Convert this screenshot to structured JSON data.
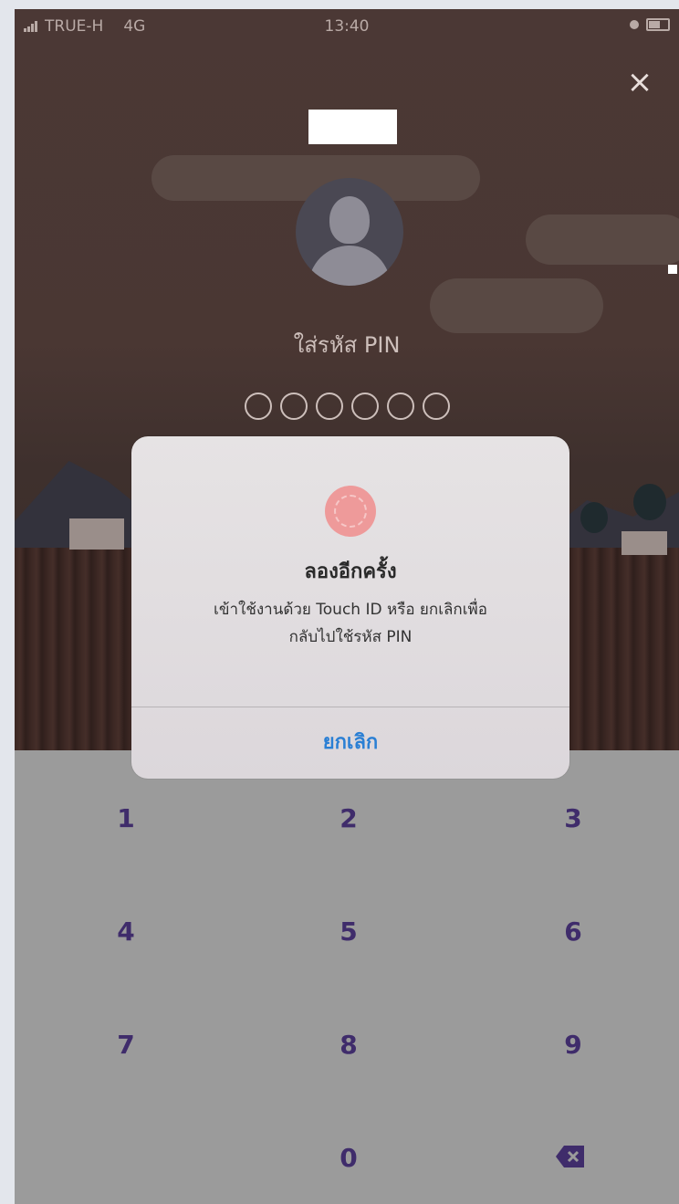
{
  "status_bar": {
    "carrier": "TRUE-H",
    "network": "4G",
    "time": "13:40"
  },
  "pin_screen": {
    "label": "ใส่รหัส PIN",
    "dots_total": 6,
    "dots_filled": 0
  },
  "dialog": {
    "title": "ลองอีกครั้ง",
    "message_line1": "เข้าใช้งานด้วย Touch ID หรือ ยกเลิกเพื่อ",
    "message_line2": "กลับไปใช้รหัส PIN",
    "cancel_label": "ยกเลิก"
  },
  "keypad": {
    "k1": "1",
    "k2": "2",
    "k3": "3",
    "k4": "4",
    "k5": "5",
    "k6": "6",
    "k7": "7",
    "k8": "8",
    "k9": "9",
    "k0": "0"
  },
  "icons": {
    "close": "close-icon",
    "avatar": "user-avatar-icon",
    "fingerprint": "fingerprint-icon",
    "backspace": "backspace-icon"
  },
  "colors": {
    "keypad_digit": "#3f2c6b",
    "dialog_button": "#2a7fd4",
    "fingerprint": "#ee9a9a"
  }
}
